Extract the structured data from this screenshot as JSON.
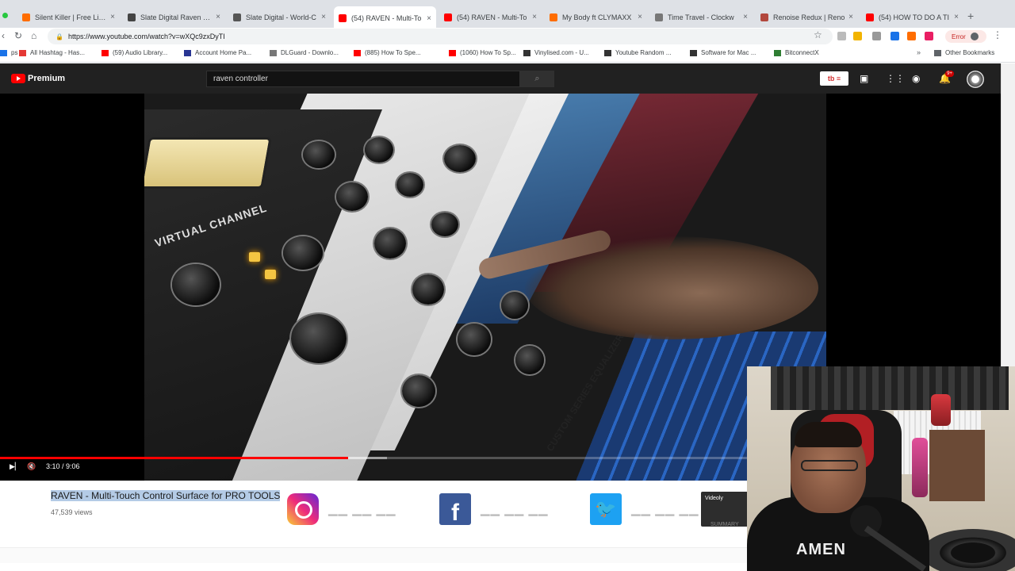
{
  "browser": {
    "tabs": [
      {
        "title": "Silent Killer | Free Liste",
        "favicon_color": "#ff6d00",
        "active": false
      },
      {
        "title": "Slate Digital Raven MTi",
        "favicon_color": "#444444",
        "active": false
      },
      {
        "title": "Slate Digital - World-C",
        "favicon_color": "#555555",
        "active": false
      },
      {
        "title": "(54) RAVEN - Multi-To",
        "favicon_color": "#ff0000",
        "active": true
      },
      {
        "title": "(54) RAVEN - Multi-To",
        "favicon_color": "#ff0000",
        "active": false
      },
      {
        "title": "My Body ft CLYMAXX",
        "favicon_color": "#ff6d00",
        "active": false
      },
      {
        "title": "Time Travel - Clockw",
        "favicon_color": "#777777",
        "active": false
      },
      {
        "title": "Renoise Redux | Reno",
        "favicon_color": "#b2473d",
        "active": false
      },
      {
        "title": "(54) HOW TO DO A TI",
        "favicon_color": "#ff0000",
        "active": false
      }
    ],
    "url": "https://www.youtube.com/watch?v=wXQc9zxDyTI",
    "error_label": "Error",
    "bookmarks": [
      {
        "label": "ps",
        "color": "#1a73e8"
      },
      {
        "label": "All Hashtag - Has...",
        "color": "#e53935"
      },
      {
        "label": "(59) Audio Library...",
        "color": "#ff0000"
      },
      {
        "label": "Account Home Pa...",
        "color": "#283593"
      },
      {
        "label": "DLGuard - Downlo...",
        "color": "#777777"
      },
      {
        "label": "(885) How To Spe...",
        "color": "#ff0000"
      },
      {
        "label": "(1060) How To Sp...",
        "color": "#ff0000"
      },
      {
        "label": "Vinylised.com - U...",
        "color": "#333333"
      },
      {
        "label": "Youtube Random ...",
        "color": "#333333"
      },
      {
        "label": "Software for Mac ...",
        "color": "#333333"
      },
      {
        "label": "BitconnectX",
        "color": "#2e7d32"
      }
    ],
    "other_bookmarks": "Other Bookmarks"
  },
  "youtube": {
    "brand": "Premium",
    "search_value": "raven controller",
    "notification_count": "9+"
  },
  "player": {
    "time": "3:10 / 9:06",
    "progress": 0.348,
    "buffered_end": 0.387,
    "screen_labels": {
      "virtual_channel": "VIRTUAL CHANNEL",
      "equalizer": "CUSTOM SERIES EQUALIZER"
    }
  },
  "video": {
    "title": "RAVEN - Multi-Touch Control Surface for PRO TOOLS",
    "views": "47,539 views"
  },
  "overlay": {
    "vidly_title": "Videoly",
    "vidly_summary": "SUMMARY",
    "shirt_text": "AMEN"
  }
}
